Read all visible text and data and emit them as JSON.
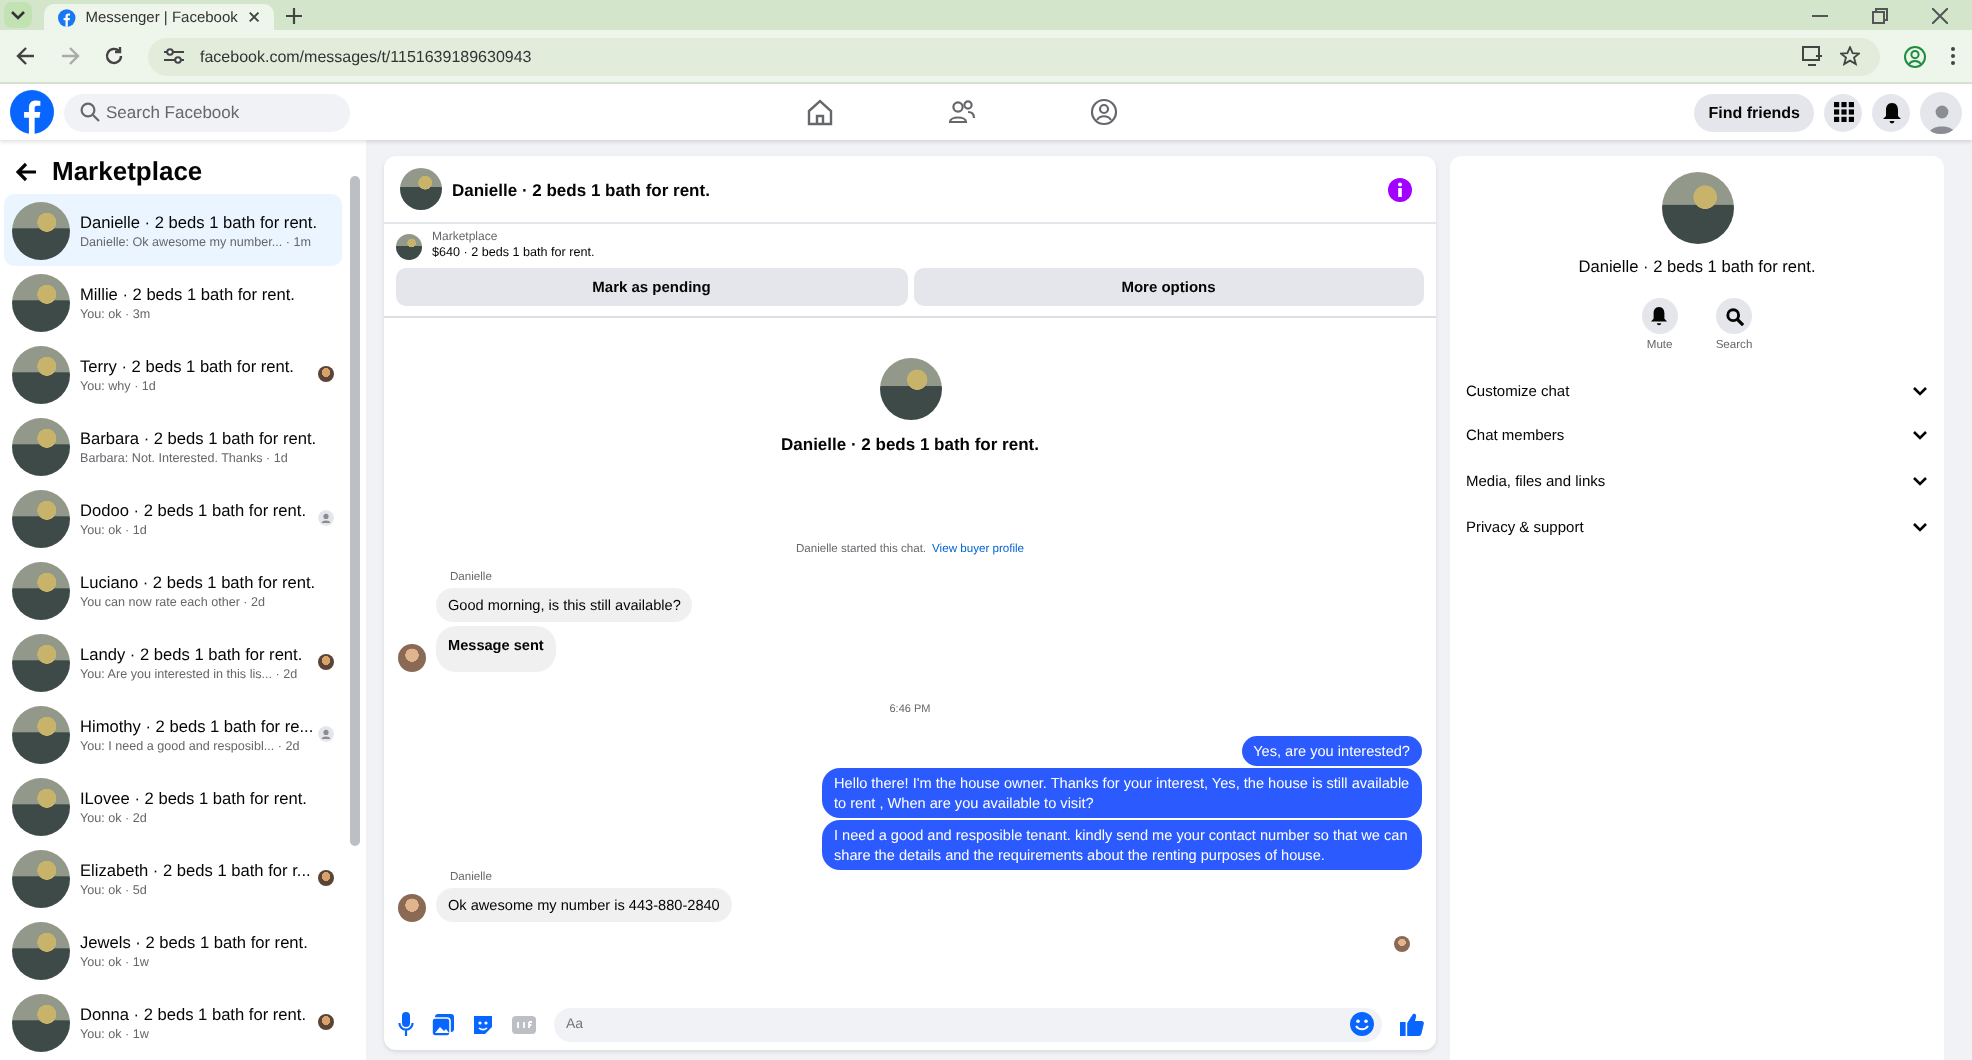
{
  "browser": {
    "tab_title": "Messenger | Facebook",
    "url": "facebook.com/messages/t/1151639189630943"
  },
  "header": {
    "search_placeholder": "Search Facebook",
    "find_friends": "Find friends"
  },
  "sidebar": {
    "title": "Marketplace",
    "items": [
      {
        "title": "Danielle · 2 beds 1 bath for rent.",
        "preview": "Danielle: Ok awesome my number... · 1m",
        "selected": true,
        "seen_photo": false,
        "seen_generic": false
      },
      {
        "title": "Millie · 2 beds 1 bath for rent.",
        "preview": "You: ok · 3m",
        "selected": false,
        "seen_photo": false,
        "seen_generic": false
      },
      {
        "title": "Terry · 2 beds 1 bath for rent.",
        "preview": "You: why · 1d",
        "selected": false,
        "seen_photo": true,
        "seen_generic": false
      },
      {
        "title": "Barbara · 2 beds 1 bath for rent.",
        "preview": "Barbara: Not. Interested. Thanks · 1d",
        "selected": false,
        "seen_photo": false,
        "seen_generic": false
      },
      {
        "title": "Dodoo · 2 beds 1 bath for rent.",
        "preview": "You: ok · 1d",
        "selected": false,
        "seen_photo": false,
        "seen_generic": true
      },
      {
        "title": "Luciano · 2 beds 1 bath for rent.",
        "preview": "You can now rate each other · 2d",
        "selected": false,
        "seen_photo": false,
        "seen_generic": false
      },
      {
        "title": "Landy · 2 beds 1 bath for rent.",
        "preview": "You: Are you interested in this lis... · 2d",
        "selected": false,
        "seen_photo": true,
        "seen_generic": false
      },
      {
        "title": "Himothy · 2 beds 1 bath for re...",
        "preview": "You: I need a good and resposibl... · 2d",
        "selected": false,
        "seen_photo": false,
        "seen_generic": true
      },
      {
        "title": "ILovee · 2 beds 1 bath for rent.",
        "preview": "You: ok · 2d",
        "selected": false,
        "seen_photo": false,
        "seen_generic": false
      },
      {
        "title": "Elizabeth · 2 beds 1 bath for r...",
        "preview": "You: ok · 5d",
        "selected": false,
        "seen_photo": true,
        "seen_generic": false
      },
      {
        "title": "Jewels · 2 beds 1 bath for rent.",
        "preview": "You: ok · 1w",
        "selected": false,
        "seen_photo": false,
        "seen_generic": false
      },
      {
        "title": "Donna · 2 beds 1 bath for rent.",
        "preview": "You: ok · 1w",
        "selected": false,
        "seen_photo": true,
        "seen_generic": false
      }
    ]
  },
  "chat": {
    "title": "Danielle · 2 beds 1 bath for rent.",
    "listing": {
      "label": "Marketplace",
      "price_title": "$640 · 2 beds 1 bath for rent."
    },
    "buttons": [
      "Mark as pending",
      "More options"
    ],
    "intro_name": "Danielle · 2 beds 1 bath for rent.",
    "system": {
      "text": "Danielle started this chat.",
      "link": "View buyer profile"
    },
    "messages": [
      {
        "kind": "sender",
        "text": "Danielle"
      },
      {
        "kind": "incoming",
        "text": "Good morning, is this still available?",
        "avatar": false,
        "bold": false
      },
      {
        "kind": "incoming",
        "text": "Message sent",
        "avatar": true,
        "bold": true
      },
      {
        "kind": "time",
        "text": "6:46 PM"
      },
      {
        "kind": "outgoing",
        "text": "Yes, are you interested?"
      },
      {
        "kind": "outgoing",
        "text": "Hello there! I'm the house owner. Thanks for your interest, Yes, the house is still available to rent , When are you available to visit?"
      },
      {
        "kind": "outgoing",
        "text": "I need a good and resposible tenant.  kindly send me your contact number so that we can share the details and the requirements about the renting purposes of house."
      },
      {
        "kind": "sender",
        "text": "Danielle"
      },
      {
        "kind": "incoming",
        "text": "Ok awesome my number is 443-880-2840",
        "avatar": true,
        "bold": false
      },
      {
        "kind": "seen"
      }
    ],
    "composer_placeholder": "Aa"
  },
  "info": {
    "name": "Danielle · 2 beds 1 bath for rent.",
    "actions": [
      "Mute",
      "Search"
    ],
    "sections": [
      "Customize chat",
      "Chat members",
      "Media, files and links",
      "Privacy & support"
    ]
  }
}
